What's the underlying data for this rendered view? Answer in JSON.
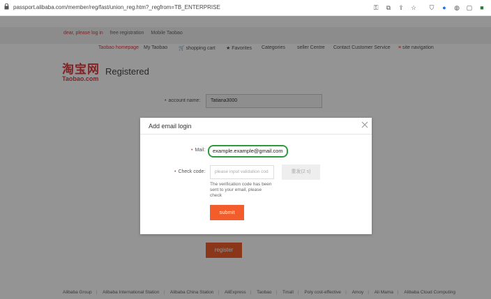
{
  "browser": {
    "url": "passport.alibaba.com/member/reg/fast/union_reg.htm?_regfrom=TB_ENTERPRISE",
    "icons": [
      "key-icon",
      "translate-icon",
      "share-icon",
      "star-icon",
      "shield-icon",
      "extension-icon",
      "extension-icon-2",
      "extension-icon-3",
      "extension-icon-4"
    ]
  },
  "toplinks": {
    "greeting": "dear, please log in",
    "free_registration": "free registration",
    "mobile": "Mobile Taobao"
  },
  "nav": {
    "homepage": "Taobao homepage",
    "my_taobao": "My Taobao",
    "cart": "shopping cart",
    "favorites": "Favorites",
    "categories": "Categories",
    "seller": "seller Centre",
    "contact": "Contact Customer Service",
    "site_nav": "site navigation"
  },
  "logo": {
    "cn": "淘宝网",
    "en": "Taobao.com"
  },
  "page_title": "Registered",
  "form": {
    "account_label": "account name:",
    "account_value": "Tatiana3000",
    "register_label": "register"
  },
  "modal": {
    "title": "Add email login",
    "mail_label": "Mail:",
    "mail_value": "example.example@gmail.com",
    "check_label": "Check code:",
    "check_placeholder": "please input validation cod",
    "resend_label": "重发(2 s)",
    "hint": "The verification code has been sent to your email, please check",
    "submit_label": "submit"
  },
  "footer": [
    "Alibaba Group",
    "Alibaba International Station",
    "Alibaba China Station",
    "AliExpress",
    "Taobao",
    "Tmall",
    "Poly cost-effective",
    "Amoy",
    "Ali Mama",
    "Alibaba Cloud Computing"
  ],
  "colors": {
    "accent": "#f25d2b",
    "brand_red": "#e4393c",
    "mail_highlight": "#2e9a3f"
  }
}
